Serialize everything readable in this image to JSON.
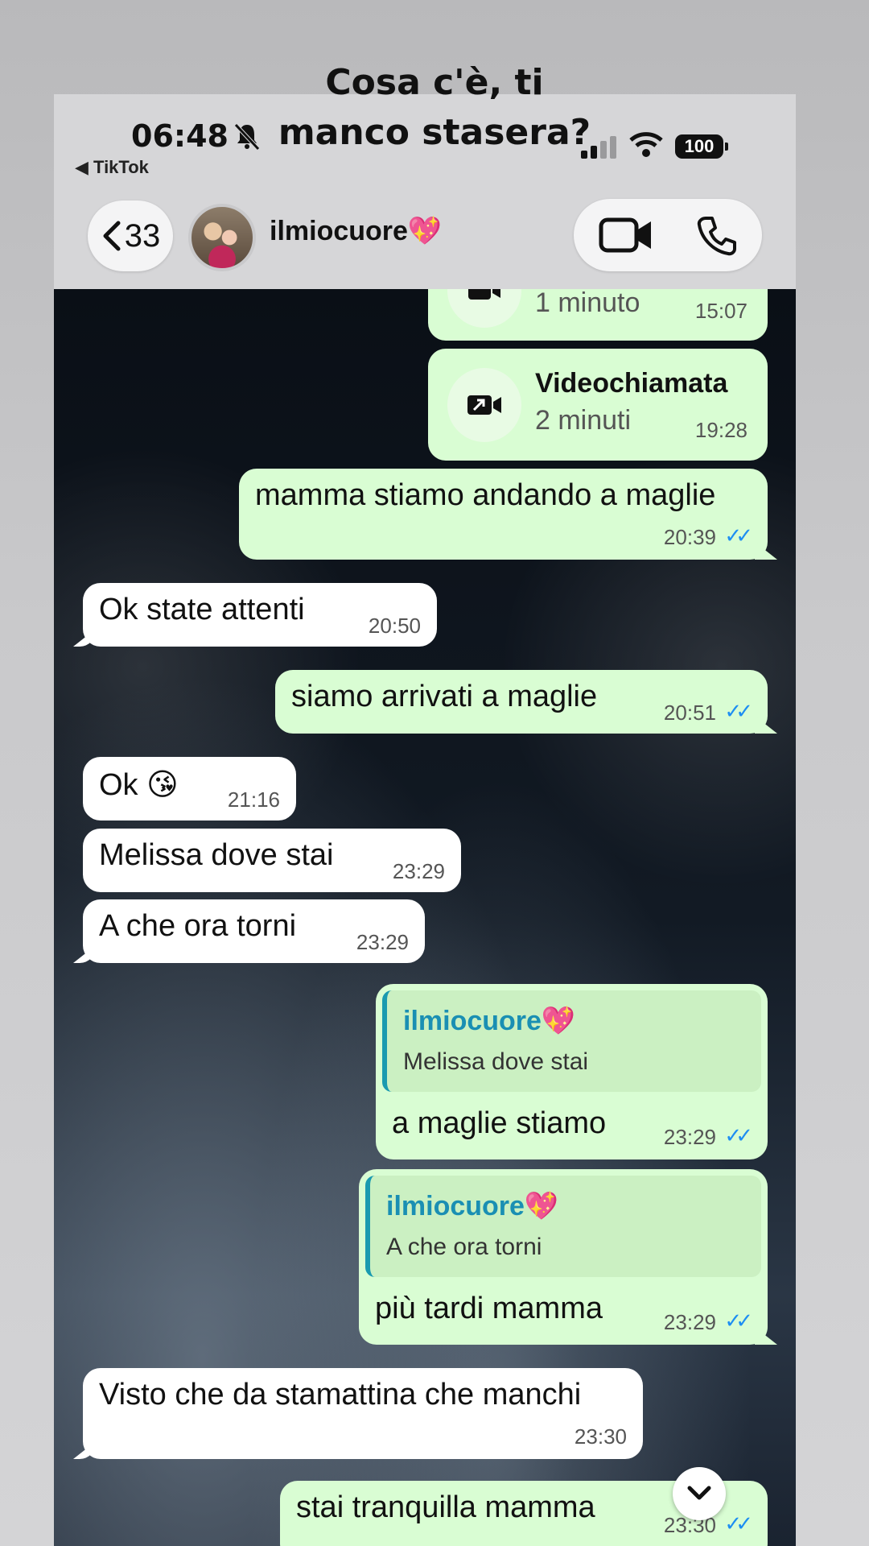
{
  "overlay": {
    "line1": "Cosa c'è, ti",
    "line2": "manco stasera?"
  },
  "status_bar": {
    "time": "06:48",
    "back_app": "◀ TikTok",
    "battery": "100"
  },
  "header": {
    "back_count": "33",
    "contact_name": "ilmiocuore💖"
  },
  "calls": [
    {
      "title": "",
      "duration": "1 minuto",
      "time": "15:07"
    },
    {
      "title": "Videochiamata",
      "duration": "2 minuti",
      "time": "19:28"
    }
  ],
  "messages": [
    {
      "text": "mamma stiamo andando a maglie",
      "time": "20:39"
    },
    {
      "text": "Ok state attenti",
      "time": "20:50"
    },
    {
      "text": "siamo arrivati a maglie",
      "time": "20:51"
    },
    {
      "text": "Ok 😘",
      "time": "21:16"
    },
    {
      "text": "Melissa dove stai",
      "time": "23:29"
    },
    {
      "text": "A che ora torni",
      "time": "23:29"
    },
    {
      "quote_name": "ilmiocuore💖",
      "quote_text": "Melissa dove stai",
      "text": "a maglie stiamo",
      "time": "23:29"
    },
    {
      "quote_name": "ilmiocuore💖",
      "quote_text": "A che ora torni",
      "text": "più tardi mamma",
      "time": "23:29"
    },
    {
      "text": "Visto che da stamattina che manchi",
      "time": "23:30"
    },
    {
      "text": "stai tranquilla mamma",
      "time": "23:30"
    }
  ],
  "colors": {
    "incoming": "#ffffff",
    "outgoing": "#d9fdd3",
    "read_ticks": "#1d8ef2",
    "quote_accent": "#1a9ab0"
  }
}
